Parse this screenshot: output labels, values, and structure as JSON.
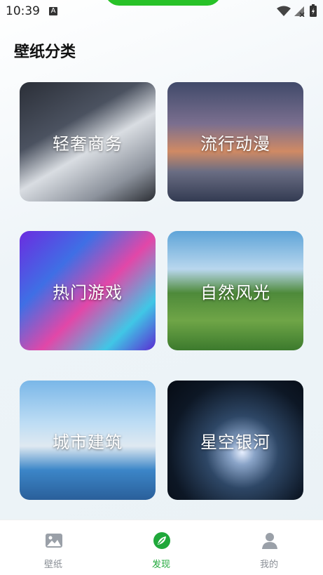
{
  "status_bar": {
    "time": "10:39"
  },
  "page": {
    "title": "壁纸分类"
  },
  "categories": [
    {
      "label": "轻奢商务"
    },
    {
      "label": "流行动漫"
    },
    {
      "label": "热门游戏"
    },
    {
      "label": "自然风光"
    },
    {
      "label": "城市建筑"
    },
    {
      "label": "星空银河"
    }
  ],
  "tabbar": {
    "items": [
      {
        "label": "壁纸",
        "icon": "image-icon"
      },
      {
        "label": "发现",
        "icon": "leaf-icon"
      },
      {
        "label": "我的",
        "icon": "person-icon"
      }
    ],
    "active_color": "#1fa83a",
    "inactive_color": "#8a8f96"
  }
}
